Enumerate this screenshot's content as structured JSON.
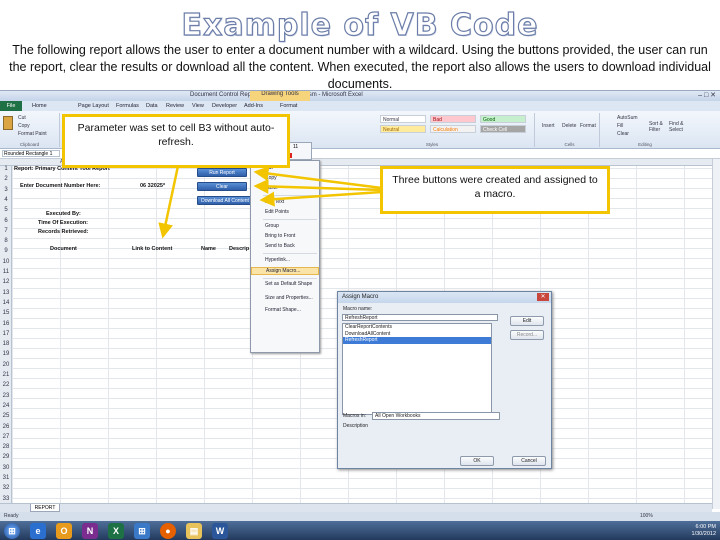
{
  "slide": {
    "title": "Example of VB Code",
    "description": "The following report allows the user to enter a document number with a wildcard. Using the buttons provided, the user can run the report, clear the results or download all the content. When executed, the report also allows the users to download individual documents."
  },
  "excel": {
    "window_title": "Document Control Report (Latest Version) Xlsm - Microsoft Excel",
    "context_tab": "Drawing Tools",
    "tabs": {
      "file": "File",
      "items": [
        "Home",
        "Page Layout",
        "Formulas",
        "Data",
        "Review",
        "View",
        "Developer",
        "Add-Ins",
        "Format"
      ]
    },
    "ribbon": {
      "clipboard": {
        "cut": "Cut",
        "copy": "Copy",
        "format_painter": "Format Paint",
        "label": "Clipboard"
      },
      "styles": {
        "normal": "Normal",
        "bad": "Bad",
        "good": "Good",
        "neutral": "Neutral",
        "calculation": "Calculation",
        "check_cell": "Check Cell",
        "label": "Styles"
      },
      "cells": {
        "insert": "Insert",
        "delete": "Delete",
        "format": "Format",
        "label": "Cells"
      },
      "editing": {
        "autosum": "AutoSum",
        "fill": "Fill",
        "clear": "Clear",
        "sort": "Sort & Filter",
        "find": "Find & Select",
        "label": "Editing"
      }
    },
    "name_box": "Rounded Rectangle 1",
    "columns": [
      "A",
      "B",
      "C",
      "D",
      "E"
    ],
    "rows": [
      "1",
      "2",
      "3",
      "4",
      "5",
      "6",
      "7",
      "8",
      "9",
      "10",
      "11",
      "12",
      "13",
      "14",
      "15",
      "16",
      "17",
      "18",
      "19",
      "20",
      "21",
      "22",
      "23",
      "24",
      "25",
      "26",
      "27",
      "28",
      "29",
      "30",
      "31",
      "32",
      "33"
    ],
    "cells": {
      "report_title": "Report: Primary Content Tool Report",
      "doc_number_label": "Enter Document Number Here:",
      "doc_number_value": "06 32025*",
      "executed_by": "Executed By:",
      "time_of_execution": "Time Of Execution:",
      "records_retrieved": "Records Retrieved:",
      "hdr_document": "Document",
      "hdr_link": "Link to Content",
      "hdr_name": "Name",
      "hdr_description": "Descrip"
    },
    "buttons": {
      "run": "Run Report",
      "clear": "Clear",
      "download": "Download All Content"
    },
    "mini_toolbar": {
      "font": "Calibri (B",
      "size": "11"
    },
    "context_menu": [
      "Cut",
      "Copy",
      "Paste",
      "Edit Text",
      "Edit Points",
      "Group",
      "Bring to Front",
      "Send to Back",
      "Hyperlink...",
      "Assign Macro...",
      "Set as Default Shape",
      "Size and Properties...",
      "Format Shape..."
    ],
    "dialog": {
      "title": "Assign Macro",
      "macro_name_label": "Macro name:",
      "macro_name_value": "RefreshReport",
      "macros": [
        "ClearReportContents",
        "DownloadAllContent",
        "RefreshReport"
      ],
      "selected_macro": "RefreshReport",
      "macros_in_label": "Macros in:",
      "macros_in_value": "All Open Workbooks",
      "description_label": "Description",
      "edit": "Edit",
      "record": "Record...",
      "ok": "OK",
      "cancel": "Cancel"
    },
    "sheet_tab": "REPORT",
    "status": "Ready",
    "zoom": "100%",
    "clock_time": "6:00 PM",
    "clock_date": "1/30/2012"
  },
  "callouts": {
    "parameter": "Parameter was set to cell B3 without auto-refresh.",
    "buttons": "Three buttons were created and assigned to a macro."
  },
  "colors": {
    "callout_border": "#f2c500",
    "button_blue": "#2f5fa8",
    "excel_green": "#1e7145"
  },
  "icons": [
    "paste-icon",
    "windows-start-icon",
    "ie-icon",
    "outlook-icon",
    "onenote-icon",
    "excel-icon",
    "firefox-icon",
    "explorer-icon",
    "word-icon"
  ]
}
